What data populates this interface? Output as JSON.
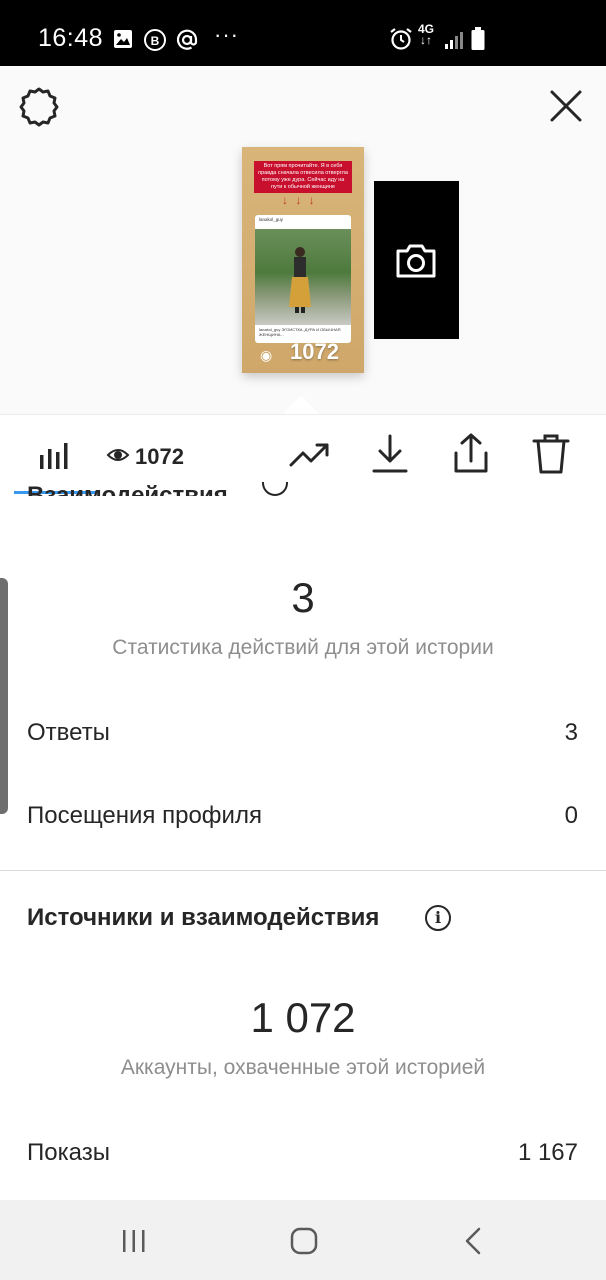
{
  "status_bar": {
    "time": "16:48",
    "network": "4G",
    "more": "···",
    "icons": [
      "image-icon",
      "vk-icon",
      "at-icon",
      "alarm-icon",
      "signal-icon",
      "battery-icon"
    ]
  },
  "header": {
    "left_icon": "gear-icon",
    "right_icon": "close-icon"
  },
  "story_preview": {
    "caption": "Вот прям прочитайте. Я в себя правда сначала отвесила отвергла потому уже дура. Сейчас иду на пути к обычной женщине",
    "arrows": "↓ ↓ ↓",
    "post_user": "lanakol_guy",
    "post_caption": "lanakol_guy ЭГОИСТКА, ДУРА И ОБЫЧНАЯ ЖЕНЩИНА...",
    "views": "1072",
    "next_icon": "camera-icon"
  },
  "toolbar": {
    "views": "1072",
    "icons": [
      "bar-chart-icon",
      "eye-icon",
      "trending-up-icon",
      "download-icon",
      "share-icon",
      "trash-icon"
    ],
    "accent": "#3897f0"
  },
  "interactions": {
    "title": "Взаимодействия",
    "value": "3",
    "subtitle": "Статистика действий для этой истории",
    "rows": [
      {
        "label": "Ответы",
        "value": "3"
      },
      {
        "label": "Посещения профиля",
        "value": "0"
      }
    ]
  },
  "discovery": {
    "title": "Источники и взаимодействия",
    "value": "1 072",
    "subtitle": "Аккаунты, охваченные этой историей",
    "rows": [
      {
        "label": "Показы",
        "value": "1 167"
      }
    ]
  },
  "nav_bar": {
    "icons": [
      "recent-apps-icon",
      "home-icon",
      "back-icon"
    ]
  }
}
